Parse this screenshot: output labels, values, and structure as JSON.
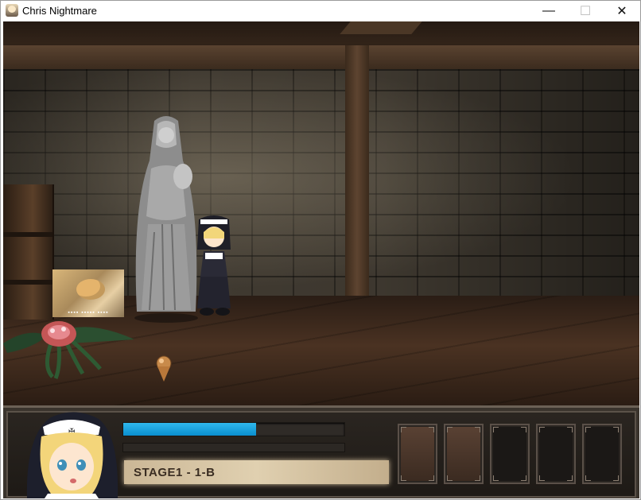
{
  "window": {
    "title": "Chris Nightmare",
    "icon": "app-icon"
  },
  "controls": {
    "minimize": "—",
    "maximize": "☐",
    "close": "✕"
  },
  "scene": {
    "thumbnail_caption": "▪▪▪▪ ▪▪▪▪▪ ▪▪▪▪"
  },
  "hud": {
    "hp_fraction": 0.6,
    "stage_label": "STAGE1 - 1-B",
    "item_slots": [
      "filled",
      "filled",
      "empty",
      "empty",
      "empty"
    ]
  },
  "colors": {
    "hp_bar": "#0a8fcf",
    "stage_plate": "#d8c6a6"
  }
}
